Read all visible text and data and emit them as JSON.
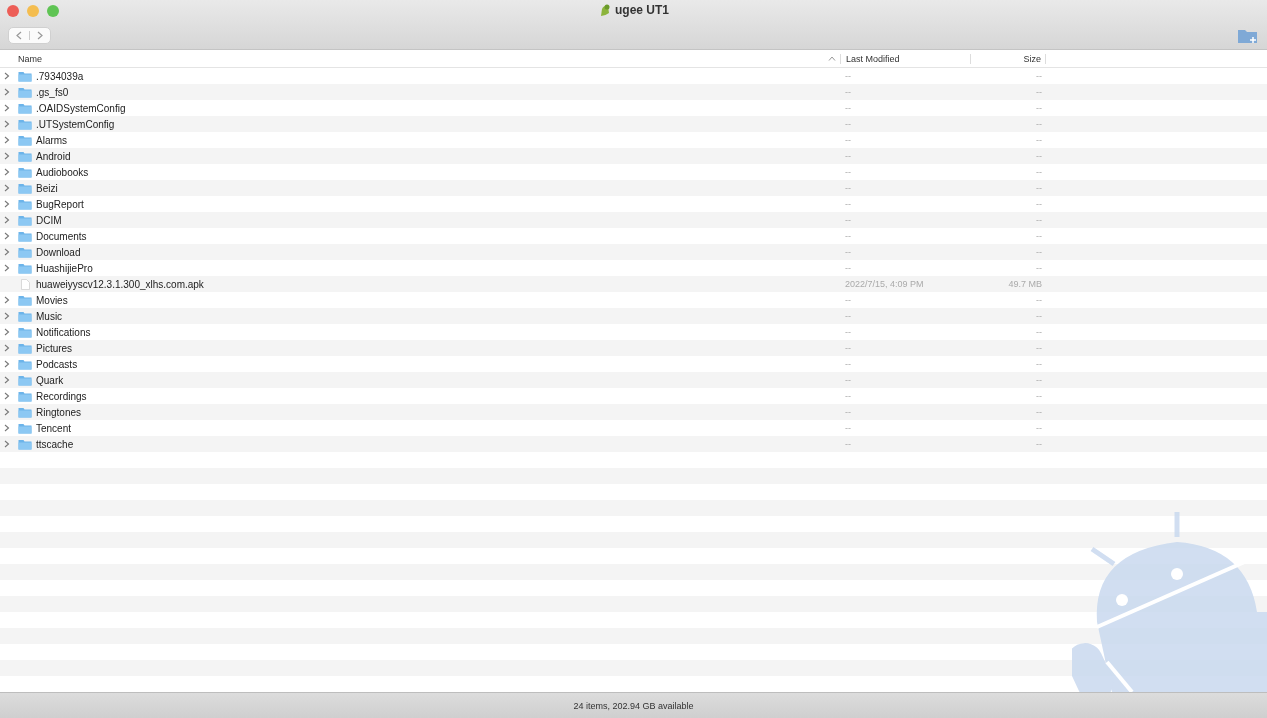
{
  "window": {
    "title": "ugee UT1"
  },
  "table": {
    "columns": [
      {
        "label": "Name"
      },
      {
        "label": "Last Modified"
      },
      {
        "label": "Size"
      }
    ],
    "rows": [
      {
        "kind": "folder",
        "name": ".7934039a",
        "modified": "--",
        "size": "--"
      },
      {
        "kind": "folder",
        "name": ".gs_fs0",
        "modified": "--",
        "size": "--"
      },
      {
        "kind": "folder",
        "name": ".OAIDSystemConfig",
        "modified": "--",
        "size": "--"
      },
      {
        "kind": "folder",
        "name": ".UTSystemConfig",
        "modified": "--",
        "size": "--"
      },
      {
        "kind": "folder",
        "name": "Alarms",
        "modified": "--",
        "size": "--"
      },
      {
        "kind": "folder",
        "name": "Android",
        "modified": "--",
        "size": "--"
      },
      {
        "kind": "folder",
        "name": "Audiobooks",
        "modified": "--",
        "size": "--"
      },
      {
        "kind": "folder",
        "name": "Beizi",
        "modified": "--",
        "size": "--"
      },
      {
        "kind": "folder",
        "name": "BugReport",
        "modified": "--",
        "size": "--"
      },
      {
        "kind": "folder",
        "name": "DCIM",
        "modified": "--",
        "size": "--"
      },
      {
        "kind": "folder",
        "name": "Documents",
        "modified": "--",
        "size": "--"
      },
      {
        "kind": "folder",
        "name": "Download",
        "modified": "--",
        "size": "--"
      },
      {
        "kind": "folder",
        "name": "HuashijiePro",
        "modified": "--",
        "size": "--"
      },
      {
        "kind": "file",
        "name": "huaweiyyscv12.3.1.300_xlhs.com.apk",
        "modified": "2022/7/15, 4:09 PM",
        "size": "49.7 MB"
      },
      {
        "kind": "folder",
        "name": "Movies",
        "modified": "--",
        "size": "--"
      },
      {
        "kind": "folder",
        "name": "Music",
        "modified": "--",
        "size": "--"
      },
      {
        "kind": "folder",
        "name": "Notifications",
        "modified": "--",
        "size": "--"
      },
      {
        "kind": "folder",
        "name": "Pictures",
        "modified": "--",
        "size": "--"
      },
      {
        "kind": "folder",
        "name": "Podcasts",
        "modified": "--",
        "size": "--"
      },
      {
        "kind": "folder",
        "name": "Quark",
        "modified": "--",
        "size": "--"
      },
      {
        "kind": "folder",
        "name": "Recordings",
        "modified": "--",
        "size": "--"
      },
      {
        "kind": "folder",
        "name": "Ringtones",
        "modified": "--",
        "size": "--"
      },
      {
        "kind": "folder",
        "name": "Tencent",
        "modified": "--",
        "size": "--"
      },
      {
        "kind": "folder",
        "name": "ttscache",
        "modified": "--",
        "size": "--"
      }
    ]
  },
  "status_bar": "24 items, 202.94 GB available"
}
